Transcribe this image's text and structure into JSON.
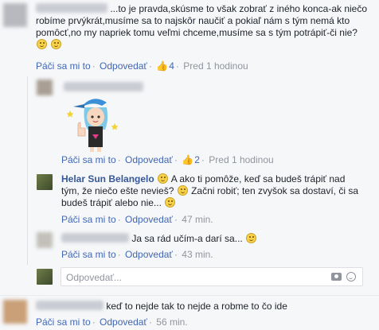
{
  "comments": [
    {
      "text": "...to je pravda,skúsme to však zobrať z iného konca-ak niečo robíme prvýkrát,musíme sa to najskôr naučiť a pokiaľ nám s tým nemá kto pomôcť,no my napriek tomu veľmi chceme,musíme sa s tým potrápiť-či nie?",
      "like_label": "Páči sa mi to",
      "reply_label": "Odpovedať",
      "like_count": "4",
      "time": "Pred 1 hodinou"
    }
  ],
  "replies": [
    {
      "sticker": "thumbs-up-girl-sticker",
      "like_label": "Páči sa mi to",
      "reply_label": "Odpovedať",
      "like_count": "2",
      "time": "Pred 1 hodinou"
    },
    {
      "author": "Helar Sun Belangelo",
      "text_line1": "A ako ti pomôže, keď sa budeš trápiť nad",
      "text_line2a": "tým, že niečo ešte nevieš?",
      "text_line2b": "Začni robiť; ten zvyšok sa dostaví, či sa",
      "text_line3": "budeš trápiť alebo nie...",
      "like_label": "Páči sa mi to",
      "reply_label": "Odpovedať",
      "time": "47 min."
    },
    {
      "text": "Ja sa rád učím-a darí sa...",
      "like_label": "Páči sa mi to",
      "reply_label": "Odpovedať",
      "time": "43 min."
    }
  ],
  "reply_input": {
    "placeholder": "Odpovedať..."
  },
  "bottom_comment": {
    "text": "keď to nejde tak to nejde a robme to čo ide",
    "like_label": "Páči sa mi to",
    "reply_label": "Odpovedať",
    "time": "56 min."
  },
  "colors": {
    "link": "#4267b2",
    "name": "#365899",
    "muted": "#90949c"
  }
}
